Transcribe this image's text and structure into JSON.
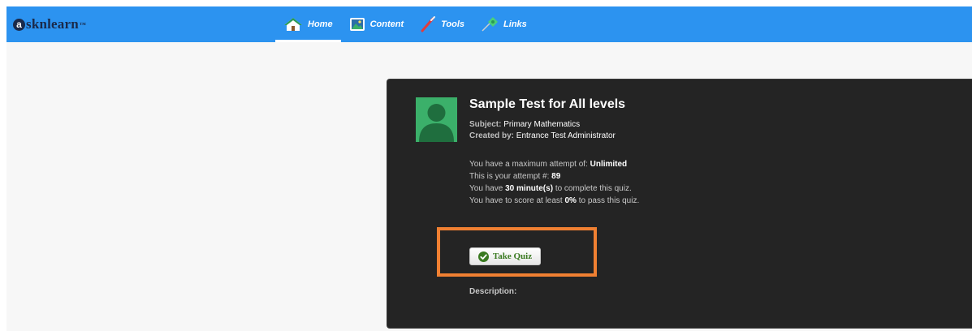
{
  "logo": {
    "text": "sknlearn",
    "initial": "a",
    "mark": "™"
  },
  "nav": {
    "items": [
      {
        "label": "Home",
        "icon": "home-icon",
        "active": true
      },
      {
        "label": "Content",
        "icon": "content-image-icon",
        "active": false
      },
      {
        "label": "Tools",
        "icon": "tools-brush-icon",
        "active": false
      },
      {
        "label": "Links",
        "icon": "links-pin-icon",
        "active": false
      }
    ]
  },
  "quiz": {
    "title": "Sample Test for All levels",
    "subject_label": "Subject:",
    "subject": "Primary Mathematics",
    "created_label": "Created by:",
    "created_by": "Entrance Test Administrator",
    "max_attempt_text": "You have a maximum attempt of:",
    "max_attempt": "Unlimited",
    "attempt_text": "This is your attempt #:",
    "attempt": "89",
    "time_prefix": "You have",
    "time_value": "30 minute(s)",
    "time_suffix": "to complete this quiz.",
    "score_prefix": "You have to score at least",
    "score_value": "0%",
    "score_suffix": "to pass this quiz.",
    "take_button": "Take Quiz",
    "description_label": "Description:"
  },
  "colors": {
    "topbar": "#2c93f0",
    "card": "#242424",
    "highlight": "#f08032",
    "button_text": "#3a7a21",
    "avatar": "#3bb06a"
  }
}
